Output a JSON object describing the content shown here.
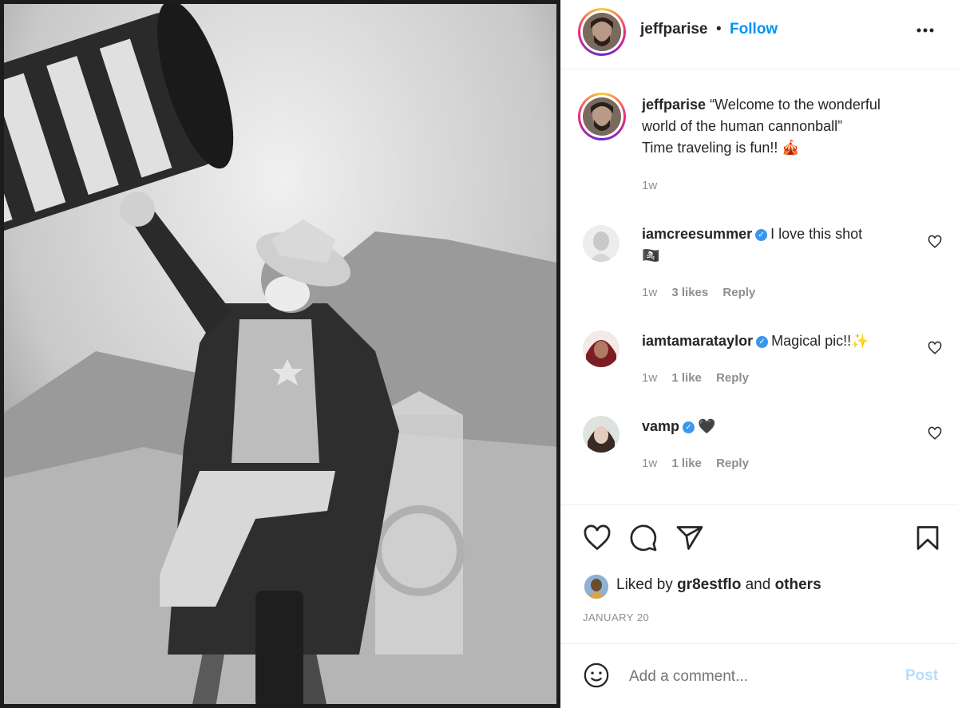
{
  "post": {
    "username": "jeffparise",
    "follow_label": "Follow",
    "separator": "•",
    "more_icon": "more-icon",
    "caption_line1": "“Welcome to the wonderful",
    "caption_line2": "world of the human cannonball”",
    "caption_line3": "Time traveling is fun!! 🎪",
    "caption_time": "1w",
    "likes_prefix": "Liked by",
    "liked_by_user": "gr8estflo",
    "likes_and": "and",
    "likes_others": "others",
    "date": "JANUARY 20"
  },
  "comments": [
    {
      "username": "iamcreesummer",
      "verified": true,
      "text_line1": "I love this shot",
      "text_line2": "🏴‍☠️",
      "time": "1w",
      "likes": "3 likes",
      "reply": "Reply"
    },
    {
      "username": "iamtamarataylor",
      "verified": true,
      "text_line1": "Magical pic!!✨",
      "time": "1w",
      "likes": "1 like",
      "reply": "Reply"
    },
    {
      "username": "vamp",
      "verified": true,
      "text_line1": "🖤",
      "time": "1w",
      "likes": "1 like",
      "reply": "Reply"
    }
  ],
  "composer": {
    "placeholder": "Add a comment...",
    "post_label": "Post"
  },
  "colors": {
    "accent": "#0095f6",
    "verified": "#3897f0",
    "muted": "#8e8e8e"
  },
  "icons": [
    "heart-icon",
    "comment-icon",
    "share-icon",
    "bookmark-icon",
    "emoji-icon",
    "verified-icon"
  ]
}
